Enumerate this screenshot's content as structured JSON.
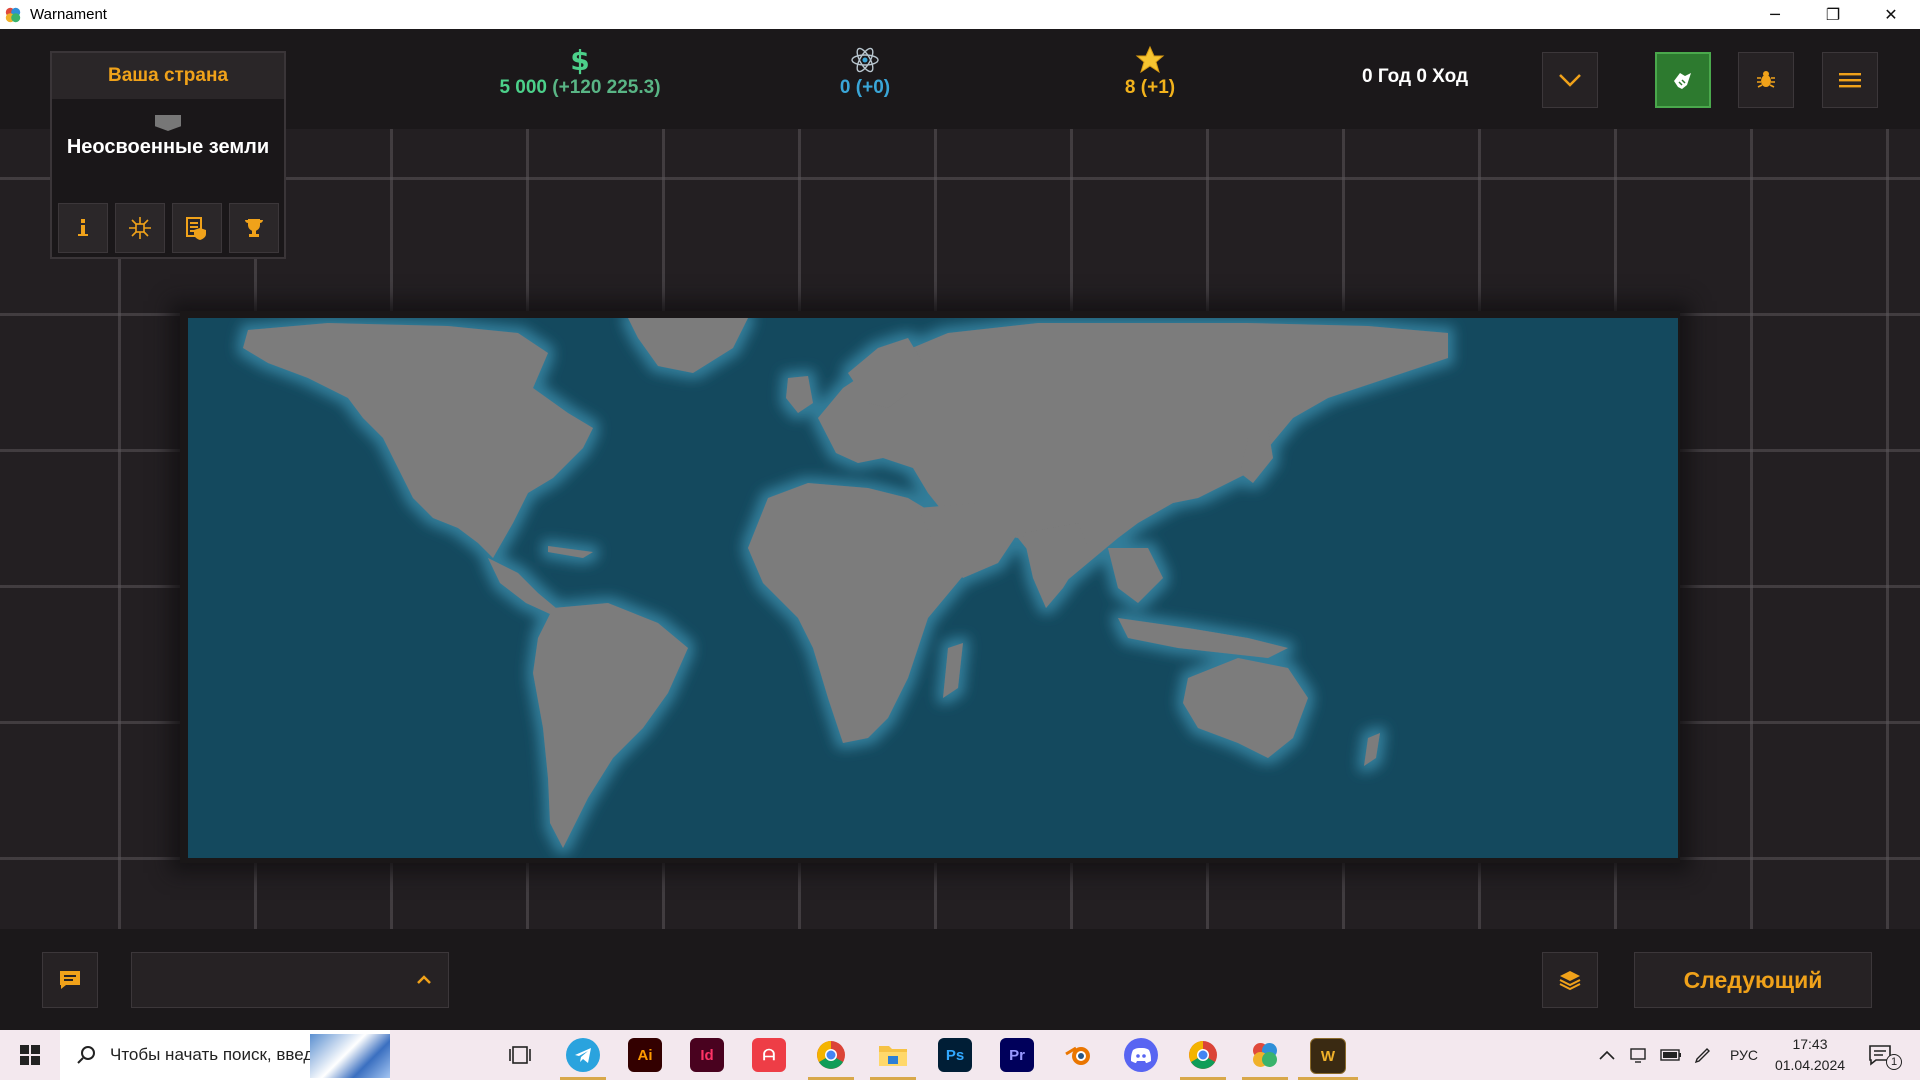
{
  "window": {
    "title": "Warnament"
  },
  "country_panel": {
    "header": "Ваша страна",
    "country_name": "Неосвоенные земли",
    "buttons": [
      {
        "icon": "info-icon"
      },
      {
        "icon": "network-icon"
      },
      {
        "icon": "document-shield-icon"
      },
      {
        "icon": "trophy-icon"
      }
    ]
  },
  "stats": {
    "money": {
      "icon": "dollar-icon",
      "value": "5 000",
      "delta": "(+120 225.3)",
      "color": "#4cd08a"
    },
    "science": {
      "icon": "atom-icon",
      "value": "0",
      "delta": "(+0)",
      "color": "#3aa6d8"
    },
    "stars": {
      "icon": "star-icon",
      "value": "8",
      "delta": "(+1)",
      "color": "#f2b21c"
    }
  },
  "turn": {
    "label": "0 Год 0 Ход"
  },
  "bottom": {
    "next_button": "Следующий"
  },
  "taskbar": {
    "search_placeholder": "Чтобы начать поиск, введите",
    "lang": "РУС",
    "time": "17:43",
    "date": "01.04.2024",
    "notifications": "1",
    "apps": [
      "task-view",
      "telegram",
      "illustrator",
      "indesign",
      "acrobat",
      "chrome",
      "file-explorer",
      "photoshop",
      "premiere",
      "blender",
      "discord",
      "chrome",
      "warnament-launcher",
      "warnament"
    ]
  },
  "colors": {
    "accent": "#f0a21a",
    "ocean": "#14495e",
    "land": "#7b7b7b",
    "green_button": "#2d7a2f"
  }
}
